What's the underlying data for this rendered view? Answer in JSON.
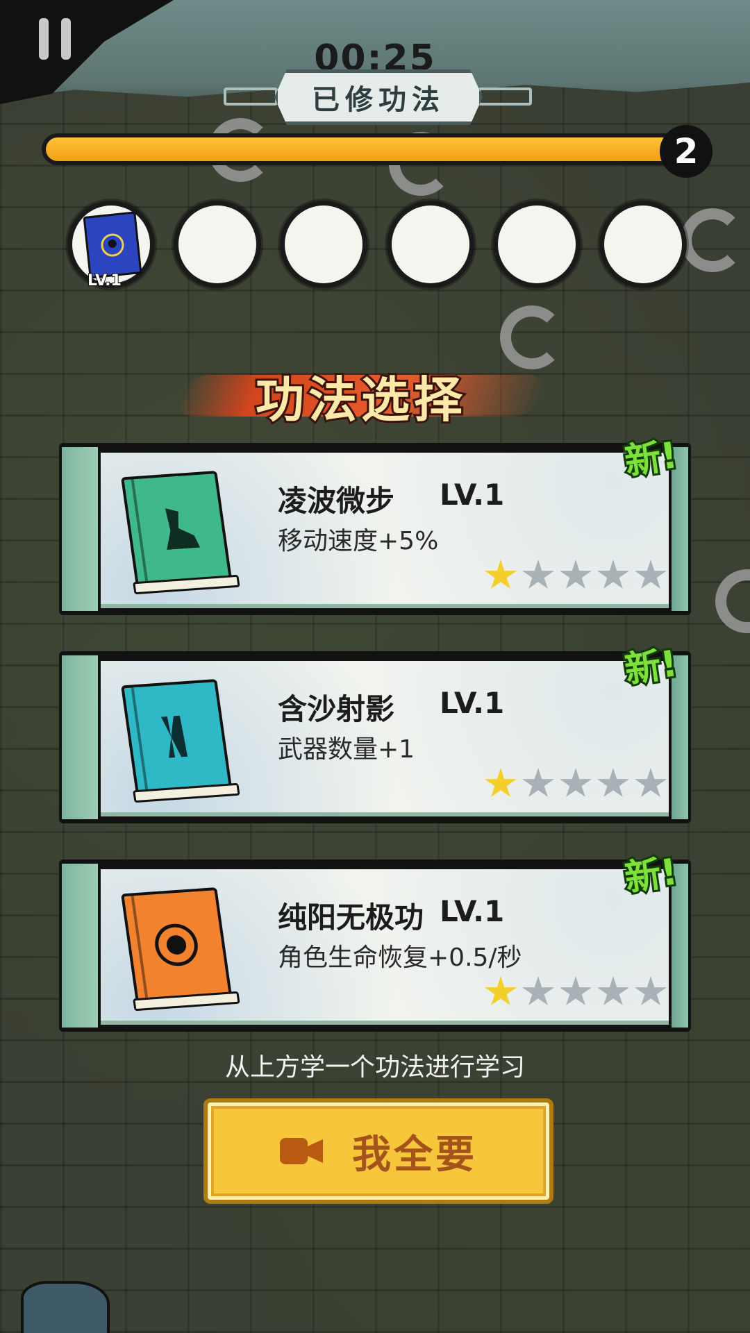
{
  "hud": {
    "timer": "00:25",
    "banner_title": "已修功法",
    "level": "2",
    "xp_progress": 0.97
  },
  "slots": {
    "filled_level": "LV.1"
  },
  "selection": {
    "title": "功法选择",
    "new_tag": "新!",
    "cards": [
      {
        "name": "凌波微步",
        "level": "LV.1",
        "desc": "移动速度+5%",
        "stars": 1,
        "book_color": "#3fb98b",
        "icon": "boot-icon"
      },
      {
        "name": "含沙射影",
        "level": "LV.1",
        "desc": "武器数量+1",
        "stars": 1,
        "book_color": "#2fb8c6",
        "icon": "claw-strike-icon"
      },
      {
        "name": "纯阳无极功",
        "level": "LV.1",
        "desc": "角色生命恢复+0.5/秒",
        "stars": 1,
        "book_color": "#f2822e",
        "icon": "fist-emblem-icon"
      }
    ],
    "hint": "从上方学一个功法进行学习",
    "cta_label": "我全要"
  }
}
